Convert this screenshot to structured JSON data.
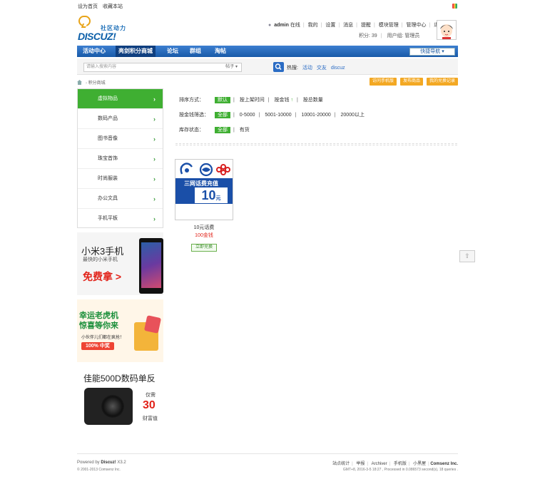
{
  "topbar": {
    "links": [
      "设为首页",
      "收藏本站"
    ]
  },
  "header": {
    "logo_brand": "DISCUZ!",
    "logo_tagline": "社区动力",
    "user": "admin",
    "online": "在线",
    "menu": [
      "我的",
      "设置",
      "消息",
      "提醒",
      "模块管理",
      "管理中心",
      "退出"
    ],
    "credits_label": "积分: 39",
    "usergroup": "用户组: 管理员"
  },
  "nav": {
    "items": [
      "活动中心",
      "亮剑积分商城",
      "论坛",
      "群组",
      "淘帖"
    ],
    "active_index": 1,
    "quick_nav": "快捷导航"
  },
  "search": {
    "placeholder": "请输入搜索内容",
    "type": "帖子",
    "hot_label": "热搜:",
    "hot_keywords": [
      "活动",
      "交友",
      "discuz"
    ]
  },
  "breadcrumb": {
    "current": "积分商城"
  },
  "actions": [
    "访问手机版",
    "发布商品",
    "我的兑换记录"
  ],
  "categories": {
    "items": [
      "虚拟物品",
      "数码产品",
      "图书音像",
      "珠宝首饰",
      "时尚服装",
      "办公文具",
      "手机平板"
    ],
    "active_index": 0
  },
  "ads": {
    "ad1": {
      "title": "小米3手机",
      "subtitle": "最快的小米手机",
      "cta": "免费拿 >"
    },
    "ad2": {
      "line1": "幸运老虎机",
      "line2": "惊喜等你来",
      "desc": "小伙伴儿们都在疯抢！",
      "badge": "100% 中奖"
    },
    "ad3": {
      "title": "佳能500D数码单反",
      "p1": "仅需",
      "p2": "30",
      "p3": "财富值"
    }
  },
  "filters": {
    "sort_label": "排序方式：",
    "sort_options": [
      "默认",
      "按上架时间",
      "按金钱",
      "按总数量"
    ],
    "range_label": "按金钱筛选：",
    "range_options": [
      "全部",
      "0-5000",
      "5001-10000",
      "10001-20000",
      "20000以上"
    ],
    "stock_label": "库存状态：",
    "stock_options": [
      "全部",
      "有货"
    ]
  },
  "product": {
    "caption": "三网话费充值",
    "value": "10",
    "unit": "元",
    "name": "10元话费",
    "price": "100金钱",
    "button": "立即兑换"
  },
  "footer": {
    "powered": "Powered by",
    "brand": "Discuz!",
    "version": "X3.2",
    "copyright": "© 2001-2013 Comsenz Inc.",
    "links": [
      "站点统计",
      "举报",
      "Archiver",
      "手机版",
      "小黑屋"
    ],
    "company": "Comsenz Inc.",
    "time": "GMT+8, 2016-3-5 18:27 , Processed in 0.086573 second(s), 18 queries ."
  },
  "colors": {
    "nav_blue": "#195aa8",
    "green": "#3faf32",
    "orange": "#f3a823",
    "price_red": "#e2231a"
  }
}
